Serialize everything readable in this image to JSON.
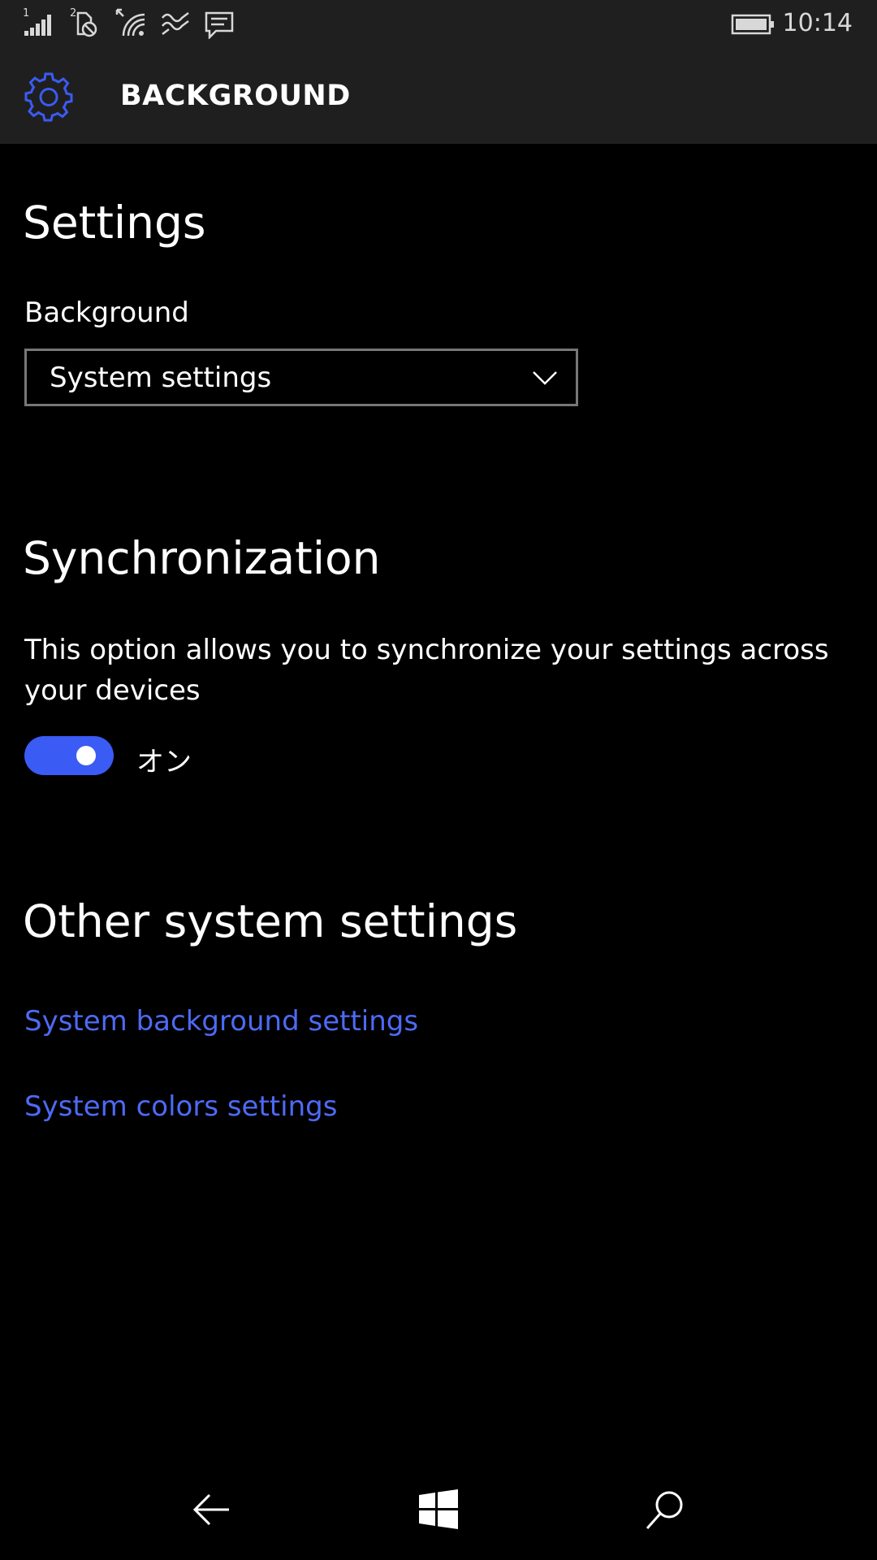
{
  "colors": {
    "accent": "#3b5bf5",
    "link": "#4d6af5",
    "bar_background": "#1f1f1f",
    "page_background": "#000000"
  },
  "status_bar": {
    "sim1_label": "1",
    "sim2_label": "2",
    "time": "10:14",
    "icons": [
      "signal-bars-icon",
      "no-sim-icon",
      "wifi-icon",
      "data-sense-icon",
      "message-icon",
      "battery-icon"
    ]
  },
  "header": {
    "icon": "gear-icon",
    "title": "BACKGROUND"
  },
  "settings_section": {
    "heading": "Settings",
    "background_label": "Background",
    "background_value": "System settings"
  },
  "sync_section": {
    "heading": "Synchronization",
    "description": "This option allows you to synchronize your settings across your devices",
    "toggle_state": true,
    "toggle_label": "オン"
  },
  "other_section": {
    "heading": "Other system settings",
    "links": [
      {
        "label": "System background settings"
      },
      {
        "label": "System colors settings"
      }
    ]
  },
  "nav_bar": {
    "buttons": [
      "back-arrow-icon",
      "windows-start-icon",
      "search-icon"
    ]
  }
}
